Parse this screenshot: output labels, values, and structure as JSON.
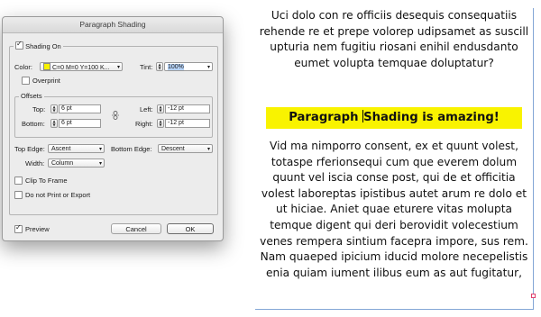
{
  "dialog": {
    "title": "Paragraph Shading",
    "shading_on_label": "Shading On",
    "color_label": "Color:",
    "color_value": "C=0 M=0 Y=100 K...",
    "tint_label": "Tint:",
    "tint_value": "100%",
    "overprint_label": "Overprint",
    "offsets_label": "Offsets",
    "top_label": "Top:",
    "top_value": "6 pt",
    "bottom_label": "Bottom:",
    "bottom_value": "6 pt",
    "left_label": "Left:",
    "left_value": "-12 pt",
    "right_label": "Right:",
    "right_value": "-12 pt",
    "top_edge_label": "Top Edge:",
    "top_edge_value": "Ascent",
    "bottom_edge_label": "Bottom Edge:",
    "bottom_edge_value": "Descent",
    "width_label": "Width:",
    "width_value": "Column",
    "clip_label": "Clip To Frame",
    "no_print_label": "Do not Print or Export",
    "preview_label": "Preview",
    "cancel_label": "Cancel",
    "ok_label": "OK",
    "checkbox_states": {
      "shading_on": true,
      "overprint": false,
      "clip": false,
      "no_print": false,
      "preview": true
    },
    "swatch_color": "#f7f200"
  },
  "document": {
    "para1": "Uci dolo con re officiis desequis consequatiis rehende re et prepe volorep udipsamet as suscill upturia nem fugitiu riosani enihil endusdanto eumet volupta temquae doluptatur?",
    "heading_before_cursor": "Paragraph ",
    "heading_after_cursor": "Shading is amazing!",
    "para2": "Vid ma nimporro consent, ex et quunt volest, totaspe rferionsequi cum que everem dolum quunt vel iscia conse post, qui de et officitia volest laboreptas ipistibus autet arum re dolo et ut hiciae. Aniet quae eturere vitas molupta temque digent qui deri berovidit volecestium venes rempera sintium facepra impore, sus rem. Nam quaeped ipicium iducid molore necepelistis enia quiam iument ilibus eum as aut fugitatur,",
    "shading_color": "#f9f300"
  }
}
